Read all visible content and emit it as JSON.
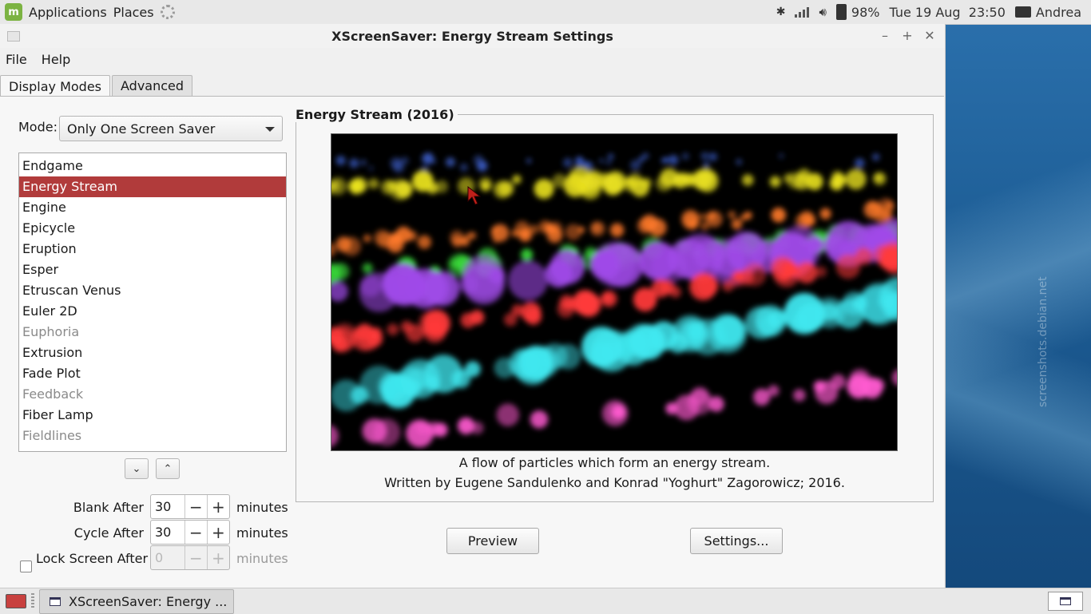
{
  "top_panel": {
    "menu_applications": "Applications",
    "menu_places": "Places",
    "battery": "98%",
    "clock": "Tue 19 Aug  23:50",
    "user": "Andrea"
  },
  "window": {
    "title": "XScreenSaver: Energy Stream Settings",
    "menu": [
      "File",
      "Help"
    ],
    "tabs": [
      "Display Modes",
      "Advanced"
    ],
    "mode_label": "Mode:",
    "mode_value": "Only One Screen Saver",
    "list": [
      {
        "label": "Endgame",
        "state": "normal"
      },
      {
        "label": "Energy Stream",
        "state": "selected"
      },
      {
        "label": "Engine",
        "state": "normal"
      },
      {
        "label": "Epicycle",
        "state": "normal"
      },
      {
        "label": "Eruption",
        "state": "normal"
      },
      {
        "label": "Esper",
        "state": "normal"
      },
      {
        "label": "Etruscan Venus",
        "state": "normal"
      },
      {
        "label": "Euler 2D",
        "state": "normal"
      },
      {
        "label": "Euphoria",
        "state": "dim"
      },
      {
        "label": "Extrusion",
        "state": "normal"
      },
      {
        "label": "Fade Plot",
        "state": "normal"
      },
      {
        "label": "Feedback",
        "state": "dim"
      },
      {
        "label": "Fiber Lamp",
        "state": "normal"
      },
      {
        "label": "Fieldlines",
        "state": "dim"
      }
    ],
    "blank_after": {
      "label": "Blank After",
      "value": "30",
      "units": "minutes"
    },
    "cycle_after": {
      "label": "Cycle After",
      "value": "30",
      "units": "minutes"
    },
    "lock_after": {
      "label": "Lock Screen After",
      "value": "0",
      "units": "minutes",
      "checked": false
    },
    "preview_frame_title": "Energy Stream (2016)",
    "description_1": "A flow of particles which form an energy stream.",
    "description_2": "Written by Eugene Sandulenko and Konrad \"Yoghurt\" Zagorowicz; 2016.",
    "preview_button": "Preview",
    "settings_button": "Settings..."
  },
  "taskbar": {
    "task_label": "XScreenSaver: Energy ..."
  },
  "watermark": "screenshots.debian.net",
  "colors": {
    "selection": "#b13b3b",
    "wallpaper": "#1f5e96",
    "particles": [
      "#e8e020",
      "#ff7a2a",
      "#3be03b",
      "#a04ae8",
      "#ff3a3a",
      "#40e8f0",
      "#ff5ad0",
      "#3a5ac0"
    ]
  }
}
